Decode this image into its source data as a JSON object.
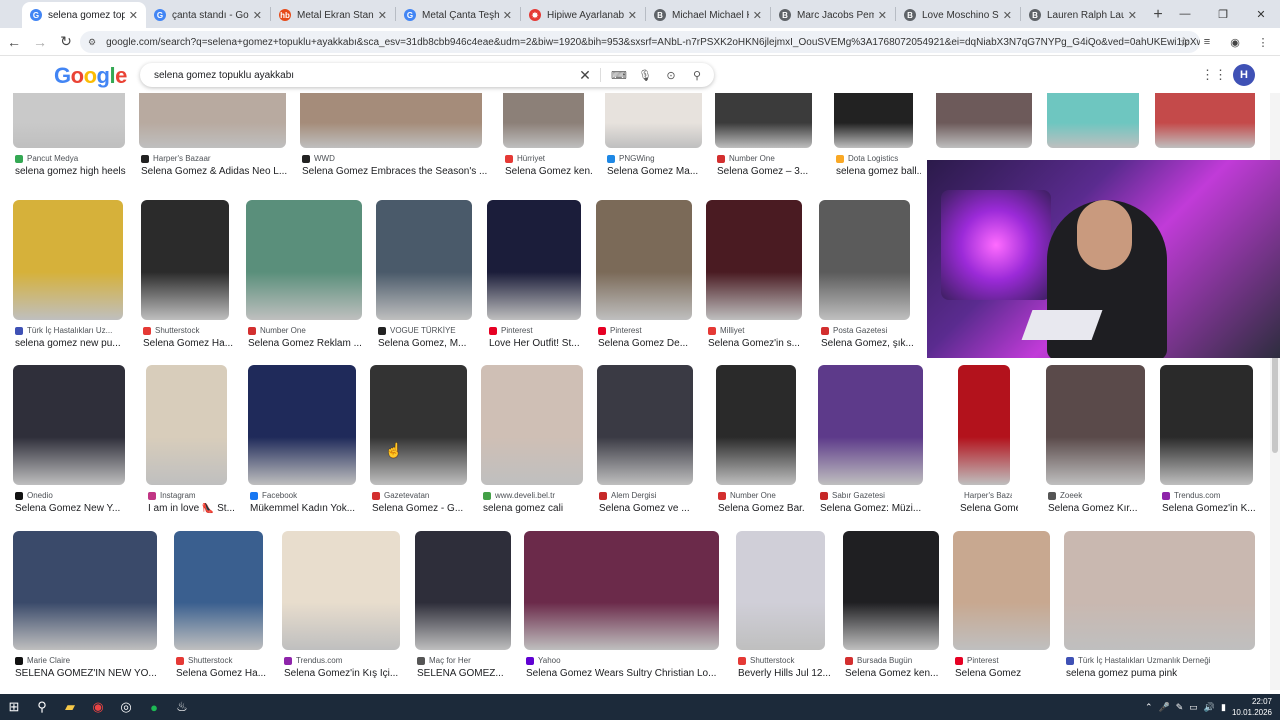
{
  "browser": {
    "tabs": [
      {
        "title": "selena gomez topukl",
        "icon": "google-icon",
        "active": true
      },
      {
        "title": "çanta standı - Googl",
        "icon": "google-icon"
      },
      {
        "title": "Metal Ekran Standı Ç",
        "icon": "hb-icon"
      },
      {
        "title": "Metal Çanta Teşhir R",
        "icon": "google-icon"
      },
      {
        "title": "Hipiwe Ayarlanabilir",
        "icon": "hipiwe-icon"
      },
      {
        "title": "Michael Michael Kor",
        "icon": "b-icon"
      },
      {
        "title": "Marc Jacobs Pembe K",
        "icon": "b-icon"
      },
      {
        "title": "Love Moschino Siyah",
        "icon": "b-icon"
      },
      {
        "title": "Lauren Ralph Lauren",
        "icon": "b-icon"
      }
    ],
    "url": "google.com/search?q=selena+gomez+topuklu+ayakkabı&sca_esv=31db8cbb946c4eae&udm=2&biw=1920&bih=953&sxsrf=ANbL-n7rPSXK2oHKN6jlejmxI_OouSVEMg%3A1768072054921&ei=dqNiabX3N7qG7NYPg_G4iQo&ved=0ahUKEwi1ipXw1..."
  },
  "google": {
    "logo": "Google",
    "query": "selena gomez topuklu ayakkabı",
    "avatar_letter": "H"
  },
  "rows": [
    {
      "items": [
        {
          "source": "Pancut Medya",
          "title": "selena gomez high heels",
          "color": "#c9c9c9",
          "src_color": "#34a853"
        },
        {
          "source": "Harper's Bazaar",
          "title": "Selena Gomez & Adidas Neo L...",
          "color": "#b8aaa0",
          "src_color": "#222"
        },
        {
          "source": "WWD",
          "title": "Selena Gomez Embraces the Season's ...",
          "color": "#a58c7a",
          "src_color": "#222"
        },
        {
          "source": "Hürriyet",
          "title": "Selena Gomez ken...",
          "color": "#8c8078",
          "src_color": "#e53935"
        },
        {
          "source": "PNGWing",
          "title": "Selena Gomez Ma...",
          "color": "#e7e2dd",
          "src_color": "#1e88e5"
        },
        {
          "source": "Number One",
          "title": "Selena Gomez – 3...",
          "color": "#3b3b3b",
          "src_color": "#d32f2f"
        },
        {
          "source": "Dota Logistics",
          "title": "selena gomez ball...",
          "color": "#222",
          "src_color": "#f9a825"
        },
        {
          "source": "",
          "title": "",
          "color": "#6d5a5a",
          "src_color": "#fff"
        },
        {
          "source": "",
          "title": "",
          "color": "#6ec6c0",
          "src_color": "#fff"
        },
        {
          "source": "",
          "title": "",
          "color": "#c44a4a",
          "src_color": "#fff"
        }
      ]
    },
    {
      "items": [
        {
          "source": "Türk İç Hastalıkları Uz...",
          "title": "selena gomez new pu...",
          "color": "#d6b13a",
          "src_color": "#3f51b5"
        },
        {
          "source": "Shutterstock",
          "title": "Selena Gomez Ha...",
          "color": "#2b2b2b",
          "src_color": "#e53935"
        },
        {
          "source": "Number One",
          "title": "Selena Gomez Reklam ...",
          "color": "#5a8f7b",
          "src_color": "#d32f2f"
        },
        {
          "source": "VOGUE TÜRKİYE",
          "title": "Selena Gomez, M...",
          "color": "#4a5a6a",
          "src_color": "#222"
        },
        {
          "source": "Pinterest",
          "title": "Love Her Outfit! St...",
          "color": "#1b1d3a",
          "src_color": "#e60023"
        },
        {
          "source": "Pinterest",
          "title": "Selena Gomez De...",
          "color": "#7b6a58",
          "src_color": "#e60023"
        },
        {
          "source": "Milliyet",
          "title": "Selena Gomez'in s...",
          "color": "#4a1b22",
          "src_color": "#e53935"
        },
        {
          "source": "Posta Gazetesi",
          "title": "Selena Gomez, şık...",
          "color": "#5b5b5b",
          "src_color": "#d32f2f"
        }
      ]
    },
    {
      "items": [
        {
          "source": "Onedio",
          "title": "Selena Gomez New Y...",
          "color": "#2f2f3a",
          "src_color": "#111"
        },
        {
          "source": "Instagram",
          "title": "I am in love 👠 St...",
          "color": "#d8cdbb",
          "src_color": "#c13584"
        },
        {
          "source": "Facebook",
          "title": "Mükemmel Kadın Yok...",
          "color": "#1f2a5a",
          "src_color": "#1877f2"
        },
        {
          "source": "Gazetevatan",
          "title": "Selena Gomez - G...",
          "color": "#333",
          "src_color": "#d32f2f"
        },
        {
          "source": "www.develi.bel.tr",
          "title": "selena gomez cali",
          "color": "#cfbfb5",
          "src_color": "#43a047"
        },
        {
          "source": "Alem Dergisi",
          "title": "Selena Gomez ve ...",
          "color": "#3a3a44",
          "src_color": "#c62828"
        },
        {
          "source": "Number One",
          "title": "Selena Gomez Bar...",
          "color": "#2a2a2a",
          "src_color": "#d32f2f"
        },
        {
          "source": "Sabır Gazetesi",
          "title": "Selena Gomez: Müzi...",
          "color": "#5d3a8a",
          "src_color": "#c62828"
        },
        {
          "source": "Harper's Bazaar",
          "title": "Selena Gomez'in V...",
          "color": "#b3121c",
          "src_color": "#222"
        },
        {
          "source": "Zoeek",
          "title": "Selena Gomez Kır...",
          "color": "#5a4a4a",
          "src_color": "#555"
        },
        {
          "source": "Trendus.com",
          "title": "Selena Gomez'in K...",
          "color": "#2a2a2a",
          "src_color": "#8e24aa"
        }
      ]
    },
    {
      "items": [
        {
          "source": "Marie Claire",
          "title": "SELENA GOMEZ'İN NEW YO...",
          "color": "#3a4a6a",
          "src_color": "#111"
        },
        {
          "source": "Shutterstock",
          "title": "Selena Gomez Ha...",
          "color": "#3a5f8f",
          "src_color": "#e53935"
        },
        {
          "source": "Trendus.com",
          "title": "Selena Gomez'in Kış İçi...",
          "color": "#e8ddcd",
          "src_color": "#8e24aa"
        },
        {
          "source": "Maç for Her",
          "title": "SELENA GOMEZ...",
          "color": "#2e2e3a",
          "src_color": "#555"
        },
        {
          "source": "Yahoo",
          "title": "Selena Gomez Wears Sultry Christian Lo...",
          "color": "#6b2a4a",
          "src_color": "#6001d2"
        },
        {
          "source": "Shutterstock",
          "title": "Beverly Hills Jul 12...",
          "color": "#d0cfd8",
          "src_color": "#e53935"
        },
        {
          "source": "Bursada Bugün",
          "title": "Selena Gomez ken...",
          "color": "#1f1f22",
          "src_color": "#d32f2f"
        },
        {
          "source": "Pinterest",
          "title": "Selena Gomez",
          "color": "#c8a890",
          "src_color": "#e60023"
        },
        {
          "source": "Türk İç Hastalıkları Uzmanlık Derneği",
          "title": "selena gomez puma pink",
          "color": "#c9b8b0",
          "src_color": "#3f51b5"
        }
      ]
    }
  ],
  "taskbar": {
    "time": "22:07",
    "date": "10.01.2026"
  }
}
